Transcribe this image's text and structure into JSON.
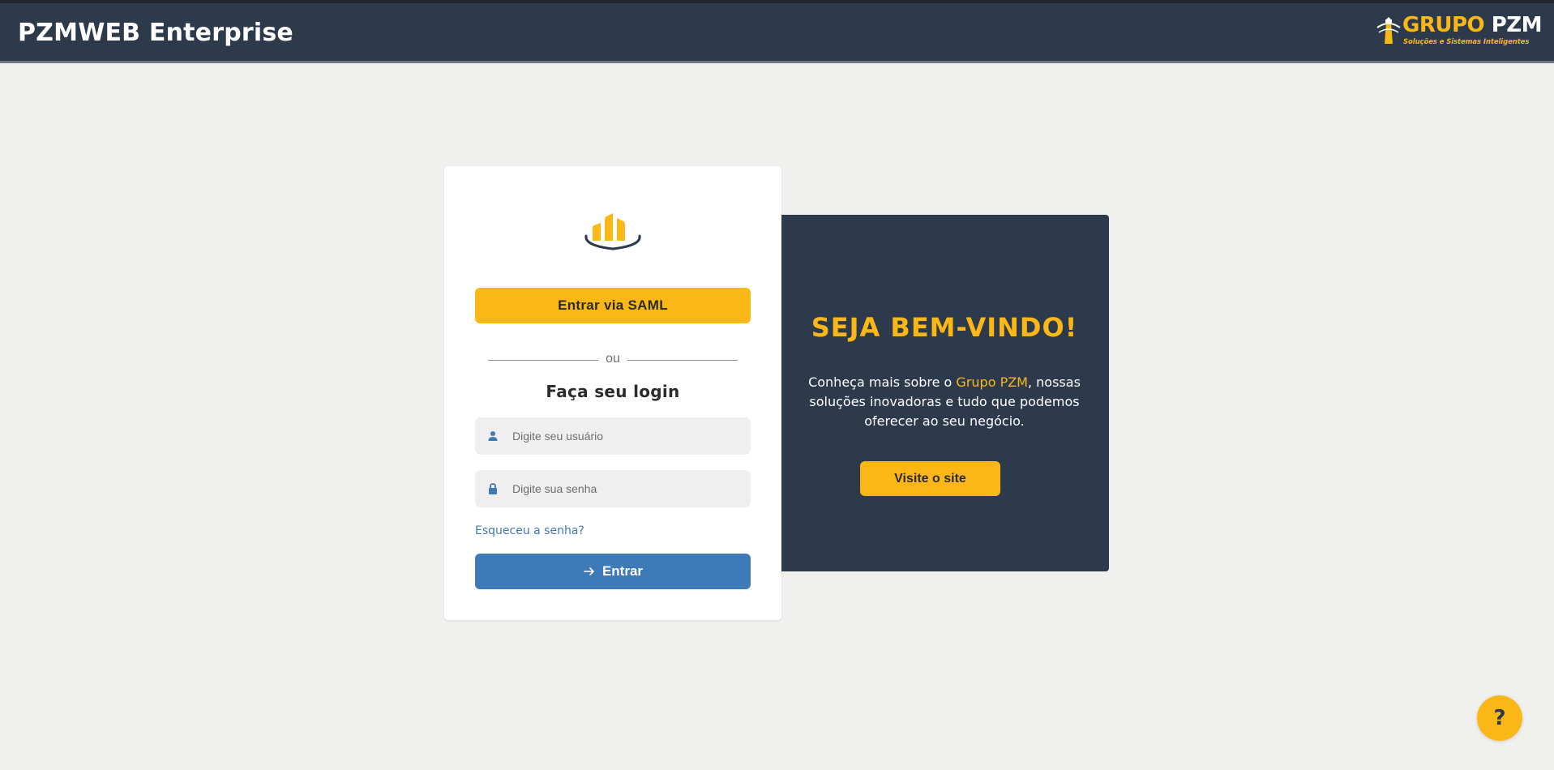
{
  "header": {
    "title": "PZMWEB Enterprise",
    "brand": {
      "grupo": "GRUPO",
      "pzm": "PZM",
      "tagline": "Soluções e Sistemas Inteligentes"
    }
  },
  "login": {
    "saml_button": "Entrar via SAML",
    "divider_text": "ou",
    "heading": "Faça seu login",
    "username_placeholder": "Digite seu usuário",
    "password_placeholder": "Digite sua senha",
    "username_value": "",
    "password_value": "",
    "forgot_link": "Esqueceu a senha?",
    "submit_button": "Entrar"
  },
  "welcome": {
    "title": "SEJA BEM-VINDO!",
    "text_before": "Conheça mais sobre o ",
    "text_highlight": "Grupo PZM",
    "text_after": ", nossas soluções inovadoras e tudo que podemos oferecer ao seu negócio.",
    "visit_button": "Visite o site"
  },
  "help": {
    "label": "?"
  },
  "colors": {
    "accent": "#fbb715",
    "primary": "#3e79b8",
    "dark": "#2c3a4c",
    "background": "#f0f0ef"
  },
  "icons": {
    "brand": "lighthouse-icon",
    "card_logo": "bar-chart-logo",
    "username": "user-icon",
    "password": "lock-icon",
    "submit": "arrow-right-icon"
  }
}
